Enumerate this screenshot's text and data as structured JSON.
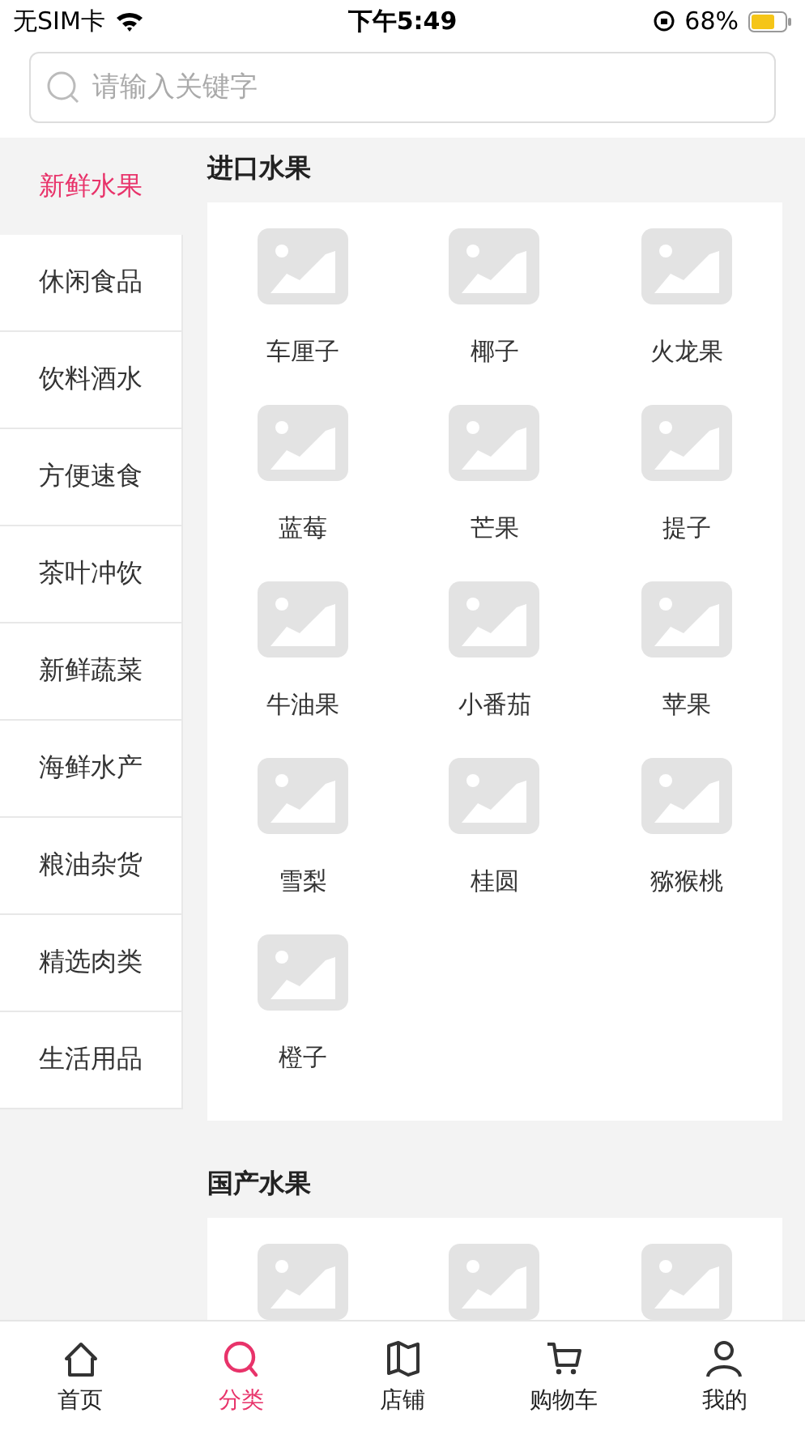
{
  "status_bar": {
    "carrier": "无SIM卡",
    "time": "下午5:49",
    "battery": "68%"
  },
  "search": {
    "placeholder": "请输入关键字"
  },
  "sidebar": {
    "items": [
      {
        "label": "新鲜水果",
        "selected": true
      },
      {
        "label": "休闲食品",
        "selected": false
      },
      {
        "label": "饮料酒水",
        "selected": false
      },
      {
        "label": "方便速食",
        "selected": false
      },
      {
        "label": "茶叶冲饮",
        "selected": false
      },
      {
        "label": "新鲜蔬菜",
        "selected": false
      },
      {
        "label": "海鲜水产",
        "selected": false
      },
      {
        "label": "粮油杂货",
        "selected": false
      },
      {
        "label": "精选肉类",
        "selected": false
      },
      {
        "label": "生活用品",
        "selected": false
      }
    ]
  },
  "sections": [
    {
      "title": "进口水果",
      "items": [
        {
          "kind": "product",
          "name": "车厘子"
        },
        {
          "kind": "product",
          "name": "椰子"
        },
        {
          "kind": "product",
          "name": "火龙果"
        },
        {
          "kind": "product",
          "name": "蓝莓"
        },
        {
          "kind": "product",
          "name": "芒果"
        },
        {
          "kind": "product",
          "name": "提子"
        },
        {
          "kind": "product",
          "name": "牛油果"
        },
        {
          "kind": "product",
          "name": "小番茄"
        },
        {
          "kind": "product",
          "name": "苹果"
        },
        {
          "kind": "product",
          "name": "雪梨"
        },
        {
          "kind": "product",
          "name": "桂圆"
        },
        {
          "kind": "product",
          "name": "猕猴桃"
        },
        {
          "kind": "product",
          "name": "橙子"
        }
      ]
    },
    {
      "title": "国产水果"
    }
  ],
  "tab_bar": {
    "items": [
      {
        "label": "首页",
        "selected": false
      },
      {
        "label": "分类",
        "selected": true
      },
      {
        "label": "店铺",
        "selected": false
      },
      {
        "label": "购物车",
        "selected": false
      },
      {
        "label": "我的",
        "selected": false
      }
    ]
  }
}
